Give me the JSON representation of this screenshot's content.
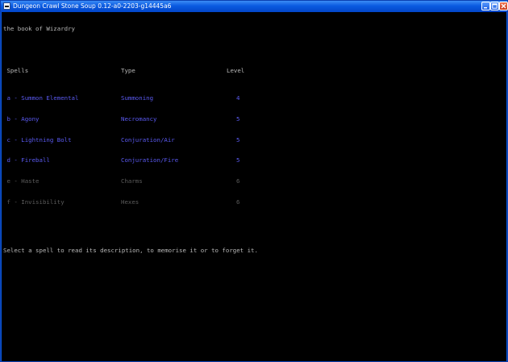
{
  "window": {
    "title": "Dungeon Crawl Stone Soup 0.12-a0-2203-g14445a6"
  },
  "book_title": "the book of Wizardry",
  "headers": {
    "spells": " Spells",
    "type": "Type",
    "level": "Level"
  },
  "spells": [
    {
      "name": " a - Summon Elemental",
      "type": "Summoning",
      "level": "4",
      "available": true
    },
    {
      "name": " b - Agony",
      "type": "Necromancy",
      "level": "5",
      "available": true
    },
    {
      "name": " c - Lightning Bolt",
      "type": "Conjuration/Air",
      "level": "5",
      "available": true
    },
    {
      "name": " d - Fireball",
      "type": "Conjuration/Fire",
      "level": "5",
      "available": true
    },
    {
      "name": " e - Haste",
      "type": "Charms",
      "level": "6",
      "available": false
    },
    {
      "name": " f - Invisibility",
      "type": "Hexes",
      "level": "6",
      "available": false
    }
  ],
  "prompt": "Select a spell to read its description, to memorise it or to forget it.",
  "colors": {
    "available_spell": "#5a5af0",
    "unavailable_spell": "#5c5c5c",
    "text": "#b8b8b8",
    "titlebar": "#0a5ae0"
  }
}
